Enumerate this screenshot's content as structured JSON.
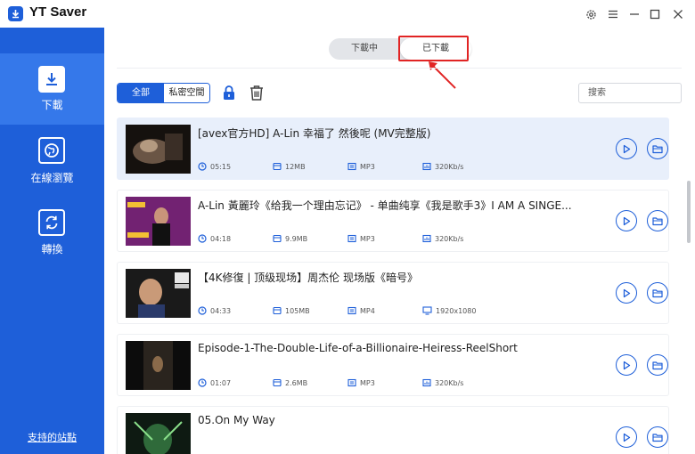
{
  "app": {
    "title": "YT Saver"
  },
  "sidebar": {
    "items": [
      {
        "label": "下載",
        "icon": "download-icon",
        "active": true
      },
      {
        "label": "在線瀏覽",
        "icon": "globe-icon",
        "active": false
      },
      {
        "label": "轉換",
        "icon": "convert-icon",
        "active": false
      }
    ],
    "support_link": "支持的站點"
  },
  "tabs": {
    "downloading": "下載中",
    "downloaded": "已下載"
  },
  "filters": {
    "all": "全部",
    "private": "私密空間"
  },
  "search": {
    "placeholder": "搜索"
  },
  "colors": {
    "brand": "#1e5fd9",
    "sidebar_active": "#3578ea",
    "annotation": "#e12424",
    "selected_row": "#e8effb"
  },
  "items": [
    {
      "title": "[avex官方HD] A-Lin 幸福了 然後呢 (MV完整版)",
      "duration": "05:15",
      "size": "12MB",
      "format": "MP3",
      "quality": "320Kb/s",
      "quality_icon": "bitrate-icon",
      "selected": true
    },
    {
      "title": "A-Lin 黃麗玲《给我一个理由忘记》 - 单曲纯享《我是歌手3》I AM A SINGE...",
      "duration": "04:18",
      "size": "9.9MB",
      "format": "MP3",
      "quality": "320Kb/s",
      "quality_icon": "bitrate-icon",
      "selected": false
    },
    {
      "title": "【4K修復 | 顶级现场】周杰伦 现场版《暗号》",
      "duration": "04:33",
      "size": "105MB",
      "format": "MP4",
      "quality": "1920x1080",
      "quality_icon": "resolution-icon",
      "selected": false
    },
    {
      "title": "Episode-1-The-Double-Life-of-a-Billionaire-Heiress-ReelShort",
      "duration": "01:07",
      "size": "2.6MB",
      "format": "MP3",
      "quality": "320Kb/s",
      "quality_icon": "bitrate-icon",
      "selected": false
    },
    {
      "title": "05.On My Way",
      "duration": "",
      "size": "",
      "format": "",
      "quality": "",
      "quality_icon": "bitrate-icon",
      "selected": false
    }
  ]
}
